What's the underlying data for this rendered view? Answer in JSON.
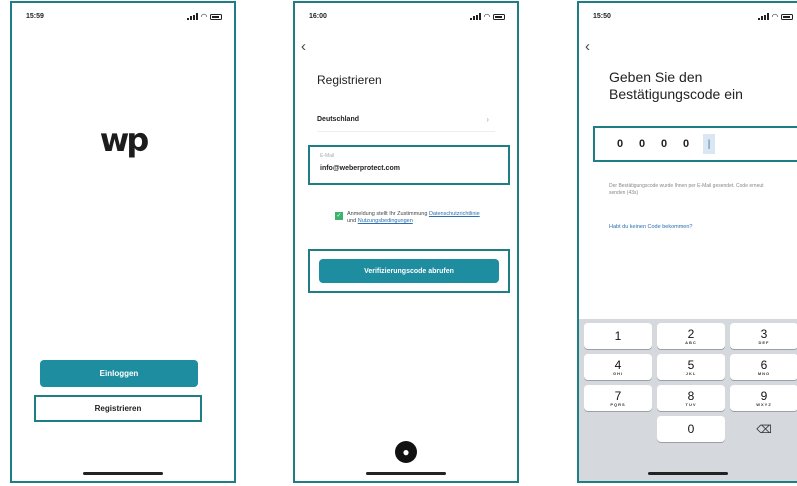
{
  "screen1": {
    "time": "15:59",
    "logo": "wp",
    "login_label": "Einloggen",
    "register_label": "Registrieren"
  },
  "screen2": {
    "time": "16:00",
    "back": "‹",
    "title": "Registrieren",
    "country": "Deutschland",
    "email_label": "E-Mail",
    "email_value": "info@weberprotect.com",
    "consent_prefix": "Anmeldung stellt Ihr Zustimmung",
    "consent_link1": "Datenschutzrichtlinie",
    "consent_and": "und",
    "consent_link2": "Nutzungsbedingungen",
    "verify_label": "Verifizierungscode abrufen"
  },
  "screen3": {
    "time": "15:50",
    "back": "‹",
    "title_line1": "Geben Sie den",
    "title_line2": "Bestätigungscode ein",
    "digits": [
      "0",
      "0",
      "0",
      "0"
    ],
    "info": "Der Bestätigungscode wurde Ihnen per E-Mail gesendet. Code erneut senden (43s)",
    "resend_link": "Habt du keinen Code bekommen?",
    "keys": [
      {
        "num": "1",
        "sub": ""
      },
      {
        "num": "2",
        "sub": "ABC"
      },
      {
        "num": "3",
        "sub": "DEF"
      },
      {
        "num": "4",
        "sub": "GHI"
      },
      {
        "num": "5",
        "sub": "JKL"
      },
      {
        "num": "6",
        "sub": "MNO"
      },
      {
        "num": "7",
        "sub": "PQRS"
      },
      {
        "num": "8",
        "sub": "TUV"
      },
      {
        "num": "9",
        "sub": "WXYZ"
      },
      {
        "num": "0",
        "sub": ""
      }
    ]
  },
  "colors": {
    "accent": "#1f8da0",
    "frame": "#1f7e84",
    "checkbox": "#3db36b",
    "link": "#2a6fb0"
  },
  "icons": {
    "signal": "signal-bars-icon",
    "wifi": "wifi-icon",
    "battery": "battery-icon",
    "back": "chevron-left-icon",
    "apple": "apple-icon",
    "delete": "backspace-icon"
  }
}
